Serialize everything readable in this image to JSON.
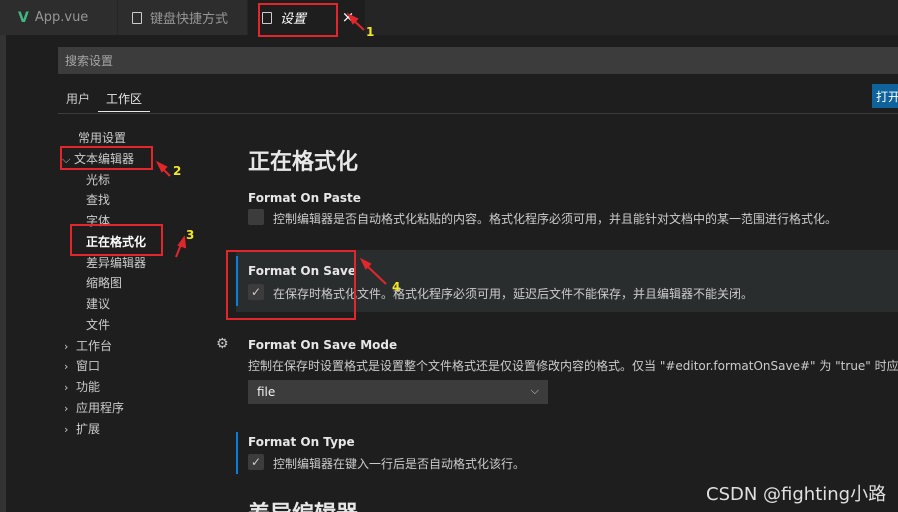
{
  "tabs": [
    {
      "label": "App.vue",
      "icon": "vue-logo-icon"
    },
    {
      "label": "键盘快捷方式",
      "icon": "file-icon"
    },
    {
      "label": "设置",
      "icon": "file-icon",
      "active": true
    }
  ],
  "tab_close": "×",
  "search": {
    "placeholder": "搜索设置"
  },
  "scope_tabs": [
    {
      "label": "用户"
    },
    {
      "label": "工作区",
      "active": true
    }
  ],
  "open_json_label": "打开",
  "toc": [
    {
      "label": "常用设置",
      "level": 0
    },
    {
      "label": "文本编辑器",
      "level": 0,
      "expanded": true
    },
    {
      "label": "光标",
      "level": 1
    },
    {
      "label": "查找",
      "level": 1
    },
    {
      "label": "字体",
      "level": 1
    },
    {
      "label": "正在格式化",
      "level": 1,
      "active": true
    },
    {
      "label": "差异编辑器",
      "level": 1
    },
    {
      "label": "缩略图",
      "level": 1
    },
    {
      "label": "建议",
      "level": 1
    },
    {
      "label": "文件",
      "level": 1
    },
    {
      "label": "工作台",
      "level": 0,
      "collapsed": true
    },
    {
      "label": "窗口",
      "level": 0,
      "collapsed": true
    },
    {
      "label": "功能",
      "level": 0,
      "collapsed": true
    },
    {
      "label": "应用程序",
      "level": 0,
      "collapsed": true
    },
    {
      "label": "扩展",
      "level": 0,
      "collapsed": true
    }
  ],
  "main": {
    "section_title": "正在格式化",
    "next_section_title": "差异编辑器",
    "settings": [
      {
        "title": "Format On Paste",
        "type": "checkbox",
        "checked": false,
        "modified": false,
        "description": "控制编辑器是否自动格式化粘贴的内容。格式化程序必须可用，并且能针对文档中的某一范围进行格式化。"
      },
      {
        "title": "Format On Save",
        "type": "checkbox",
        "checked": true,
        "modified": true,
        "description": "在保存时格式化文件。格式化程序必须可用，延迟后文件不能保存，并且编辑器不能关闭。"
      },
      {
        "title": "Format On Save Mode",
        "type": "select",
        "value": "file",
        "modified": false,
        "description": "控制在保存时设置格式是设置整个文件格式还是仅设置修改内容的格式。仅当 \"#editor.formatOnSave#\" 为 \"true\" 时应用。"
      },
      {
        "title": "Format On Type",
        "type": "checkbox",
        "checked": true,
        "modified": true,
        "description": "控制编辑器在键入一行后是否自动格式化该行。"
      }
    ]
  },
  "annotations": [
    "1",
    "2",
    "3",
    "4"
  ],
  "watermark": "CSDN @fighting小路",
  "colors": {
    "accent": "#0e639c",
    "modified_bar": "#0c7dd9",
    "annotation_red": "#e3262c",
    "annotation_yellow": "#f1e72a"
  }
}
